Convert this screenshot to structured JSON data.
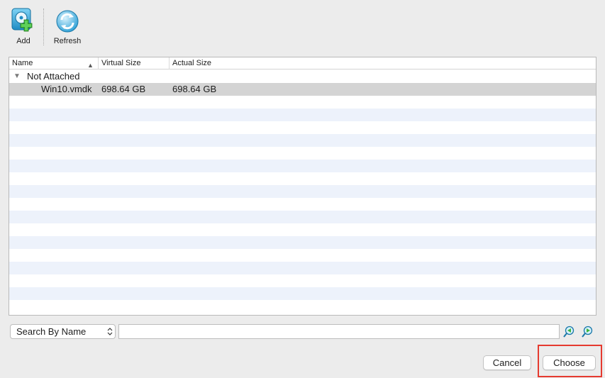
{
  "toolbar": {
    "add_label": "Add",
    "refresh_label": "Refresh",
    "add_icon": "add-disk-icon",
    "refresh_icon": "refresh-icon"
  },
  "table": {
    "columns": {
      "name": "Name",
      "virtual_size": "Virtual Size",
      "actual_size": "Actual Size"
    },
    "sort_indicator": "▲",
    "group": {
      "label": "Not Attached",
      "disclosure": "▼"
    },
    "rows": [
      {
        "name": "Win10.vmdk",
        "virtual_size": "698.64 GB",
        "actual_size": "698.64 GB",
        "selected": true
      }
    ]
  },
  "search": {
    "mode_label": "Search By Name",
    "value": "",
    "placeholder": "",
    "prev_icon": "search-previous-icon",
    "next_icon": "search-next-icon"
  },
  "buttons": {
    "cancel": "Cancel",
    "choose": "Choose"
  },
  "colors": {
    "highlight": "#e53a2f",
    "selected_row": "#d4d4d4",
    "stripe": "#edf2fb",
    "icon_teal": "#2a9fd6",
    "icon_green": "#3fb53a"
  }
}
